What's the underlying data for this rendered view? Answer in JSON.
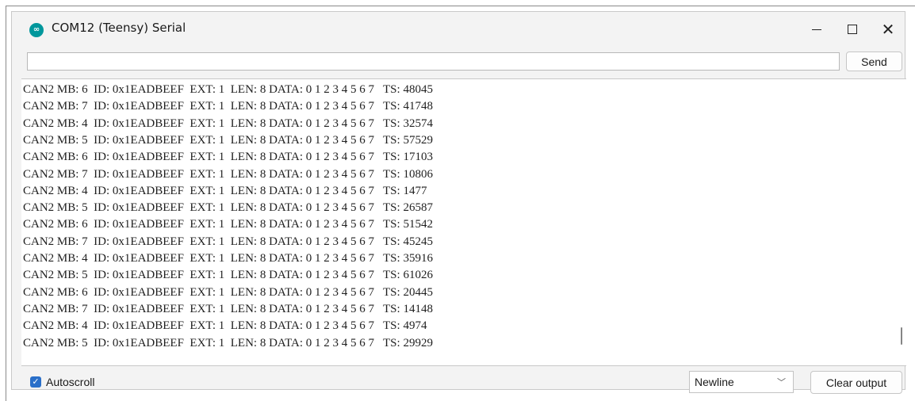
{
  "window": {
    "title": "COM12 (Teensy) Serial",
    "app_icon": "arduino-icon",
    "controls": {
      "minimize": "minimize-icon",
      "maximize": "maximize-icon",
      "close": "close-icon"
    }
  },
  "input": {
    "value": "",
    "send_label": "Send"
  },
  "output": {
    "lines": [
      "CAN2 MB: 6  ID: 0x1EADBEEF  EXT: 1  LEN: 8 DATA: 0 1 2 3 4 5 6 7   TS: 48045",
      "CAN2 MB: 7  ID: 0x1EADBEEF  EXT: 1  LEN: 8 DATA: 0 1 2 3 4 5 6 7   TS: 41748",
      "CAN2 MB: 4  ID: 0x1EADBEEF  EXT: 1  LEN: 8 DATA: 0 1 2 3 4 5 6 7   TS: 32574",
      "CAN2 MB: 5  ID: 0x1EADBEEF  EXT: 1  LEN: 8 DATA: 0 1 2 3 4 5 6 7   TS: 57529",
      "CAN2 MB: 6  ID: 0x1EADBEEF  EXT: 1  LEN: 8 DATA: 0 1 2 3 4 5 6 7   TS: 17103",
      "CAN2 MB: 7  ID: 0x1EADBEEF  EXT: 1  LEN: 8 DATA: 0 1 2 3 4 5 6 7   TS: 10806",
      "CAN2 MB: 4  ID: 0x1EADBEEF  EXT: 1  LEN: 8 DATA: 0 1 2 3 4 5 6 7   TS: 1477",
      "CAN2 MB: 5  ID: 0x1EADBEEF  EXT: 1  LEN: 8 DATA: 0 1 2 3 4 5 6 7   TS: 26587",
      "CAN2 MB: 6  ID: 0x1EADBEEF  EXT: 1  LEN: 8 DATA: 0 1 2 3 4 5 6 7   TS: 51542",
      "CAN2 MB: 7  ID: 0x1EADBEEF  EXT: 1  LEN: 8 DATA: 0 1 2 3 4 5 6 7   TS: 45245",
      "CAN2 MB: 4  ID: 0x1EADBEEF  EXT: 1  LEN: 8 DATA: 0 1 2 3 4 5 6 7   TS: 35916",
      "CAN2 MB: 5  ID: 0x1EADBEEF  EXT: 1  LEN: 8 DATA: 0 1 2 3 4 5 6 7   TS: 61026",
      "CAN2 MB: 6  ID: 0x1EADBEEF  EXT: 1  LEN: 8 DATA: 0 1 2 3 4 5 6 7   TS: 20445",
      "CAN2 MB: 7  ID: 0x1EADBEEF  EXT: 1  LEN: 8 DATA: 0 1 2 3 4 5 6 7   TS: 14148",
      "CAN2 MB: 4  ID: 0x1EADBEEF  EXT: 1  LEN: 8 DATA: 0 1 2 3 4 5 6 7   TS: 4974",
      "CAN2 MB: 5  ID: 0x1EADBEEF  EXT: 1  LEN: 8 DATA: 0 1 2 3 4 5 6 7   TS: 29929"
    ]
  },
  "footer": {
    "autoscroll_label": "Autoscroll",
    "autoscroll_checked": true,
    "line_ending": "Newline",
    "clear_label": "Clear output"
  },
  "colors": {
    "accent": "#2a6fc9",
    "arduino": "#00979c"
  }
}
